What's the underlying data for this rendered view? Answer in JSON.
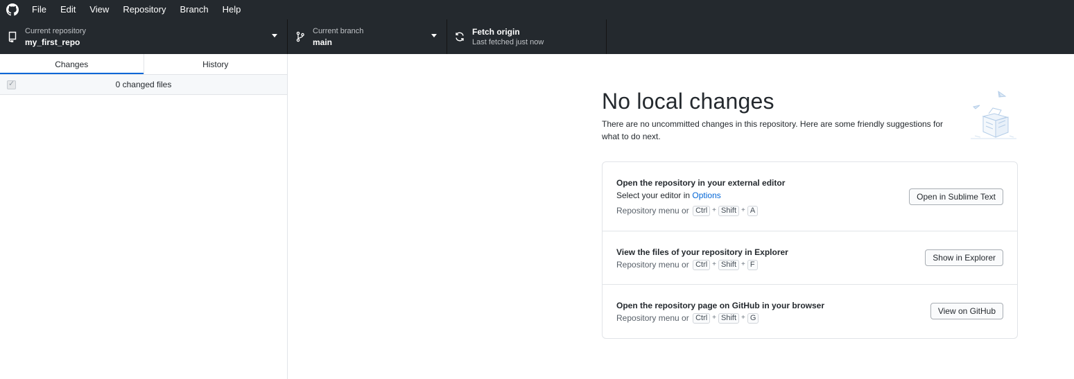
{
  "menu": {
    "items": [
      "File",
      "Edit",
      "View",
      "Repository",
      "Branch",
      "Help"
    ]
  },
  "toolbar": {
    "repository": {
      "label": "Current repository",
      "value": "my_first_repo",
      "icon": "repo-icon"
    },
    "branch": {
      "label": "Current branch",
      "value": "main",
      "icon": "branch-icon"
    },
    "fetch": {
      "label": "Fetch origin",
      "value": "Last fetched just now",
      "icon": "sync-icon"
    }
  },
  "sidebar": {
    "tabs": [
      "Changes",
      "History"
    ],
    "active_tab": "Changes",
    "changed_files": "0 changed files"
  },
  "main": {
    "title": "No local changes",
    "subtitle": "There are no uncommitted changes in this repository. Here are some friendly suggestions for what to do next.",
    "suggestions": [
      {
        "title": "Open the repository in your external editor",
        "desc_prefix": "Select your editor in ",
        "desc_link": "Options",
        "shortcut_prefix": "Repository menu or",
        "keys": [
          "Ctrl",
          "Shift",
          "A"
        ],
        "button": "Open in Sublime Text"
      },
      {
        "title": "View the files of your repository in Explorer",
        "shortcut_prefix": "Repository menu or",
        "keys": [
          "Ctrl",
          "Shift",
          "F"
        ],
        "button": "Show in Explorer"
      },
      {
        "title": "Open the repository page on GitHub in your browser",
        "shortcut_prefix": "Repository menu or",
        "keys": [
          "Ctrl",
          "Shift",
          "G"
        ],
        "button": "View on GitHub"
      }
    ]
  },
  "colors": {
    "header_bg": "#24292e",
    "accent": "#0366d6",
    "border": "#e1e4e8"
  }
}
